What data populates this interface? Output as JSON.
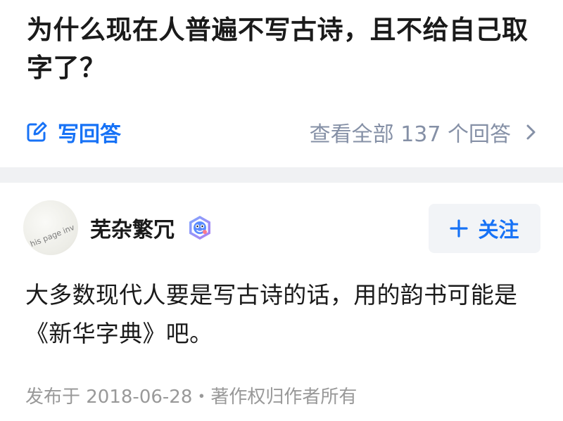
{
  "question": {
    "title": "为什么现在人普遍不写古诗，且不给自己取字了？"
  },
  "actions": {
    "write_answer_label": "写回答",
    "view_all_label": "查看全部 137 个回答",
    "answer_count": 137
  },
  "answer": {
    "author": {
      "name": "芜杂繁冗",
      "avatar_watermark": "his page inv"
    },
    "follow_label": "关注",
    "content": "大多数现代人要是写古诗的话，用的韵书可能是《新华字典》吧。",
    "meta": "发布于 2018-06-28・著作权归作者所有"
  },
  "colors": {
    "accent": "#1772f6",
    "secondary_text": "#8590a6",
    "meta_text": "#999999",
    "divider": "#f0f1f3",
    "button_bg": "#f2f4f7"
  },
  "icons": {
    "write": "edit-pencil-icon",
    "chevron": "chevron-right-icon",
    "badge": "verified-badge-icon",
    "follow": "plus-icon"
  }
}
